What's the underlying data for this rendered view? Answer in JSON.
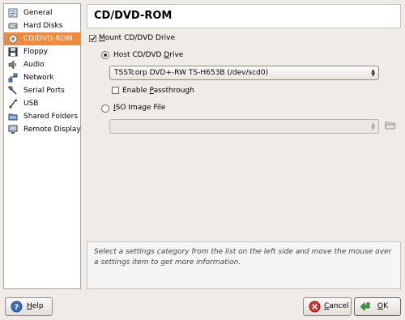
{
  "sidebar": {
    "items": [
      {
        "label": "General",
        "icon": "general-icon"
      },
      {
        "label": "Hard Disks",
        "icon": "hard-disk-icon"
      },
      {
        "label": "CD/DVD-ROM",
        "icon": "cd-icon",
        "active": true
      },
      {
        "label": "Floppy",
        "icon": "floppy-icon"
      },
      {
        "label": "Audio",
        "icon": "speaker-icon"
      },
      {
        "label": "Network",
        "icon": "network-icon"
      },
      {
        "label": "Serial Ports",
        "icon": "serial-port-icon"
      },
      {
        "label": "USB",
        "icon": "usb-icon"
      },
      {
        "label": "Shared Folders",
        "icon": "folder-icon"
      },
      {
        "label": "Remote Display",
        "icon": "monitor-icon"
      }
    ]
  },
  "page": {
    "title": "CD/DVD-ROM"
  },
  "mount": {
    "label_first": "M",
    "label_rest": "ount CD/DVD Drive",
    "checked": true
  },
  "host_drive": {
    "label_pre": "Host CD/DVD ",
    "label_ul": "D",
    "label_post": "rive",
    "selected": true,
    "combo_value": "TSSTcorp DVD+-RW TS-H653B (/dev/scd0)"
  },
  "passthrough": {
    "label_pre": "Enable ",
    "label_ul": "P",
    "label_post": "assthrough",
    "checked": false
  },
  "iso": {
    "label_first": "I",
    "label_rest": "SO Image File",
    "selected": false,
    "combo_value": ""
  },
  "info": {
    "text": "Select a settings category from the list on the left side and move the mouse over a settings item to get more information."
  },
  "buttons": {
    "help_first": "H",
    "help_rest": "elp",
    "cancel_first": "C",
    "cancel_rest": "ancel",
    "ok_first": "O",
    "ok_rest": "K"
  },
  "colors": {
    "accent": "#f08a3c"
  }
}
